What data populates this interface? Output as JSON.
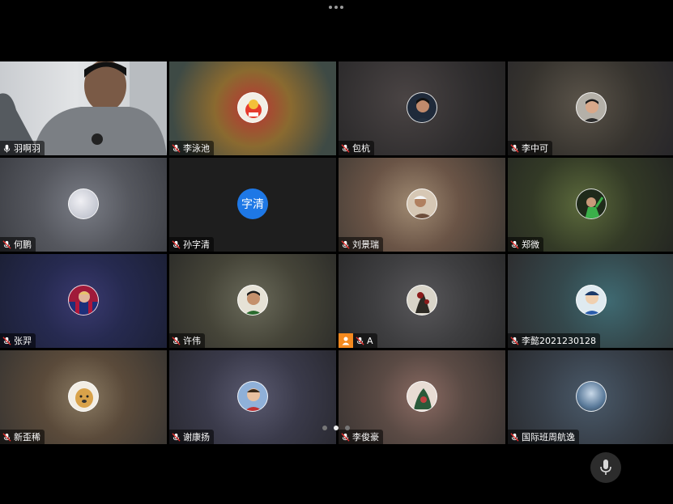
{
  "top_bar": {
    "more_icon": "more-dots-icon"
  },
  "participants": [
    {
      "name": "羽啊羽",
      "status_icon": "microphone-on-icon",
      "avatar": "camera-video",
      "accent": "#cfd3d6"
    },
    {
      "name": "李泳池",
      "status_icon": "microphone-muted-icon",
      "avatar": "photo",
      "accent": "#7c5a4a"
    },
    {
      "name": "包杭",
      "status_icon": "microphone-muted-icon",
      "avatar": "photo",
      "accent": "#3a3838"
    },
    {
      "name": "李中可",
      "status_icon": "microphone-muted-icon",
      "avatar": "photo",
      "accent": "#3c3a36"
    },
    {
      "name": "何鹏",
      "status_icon": "microphone-muted-icon",
      "avatar": "photo",
      "accent": "#55575e"
    },
    {
      "name": "孙字清",
      "status_icon": "microphone-muted-icon",
      "avatar": "text",
      "avatar_text": "字清",
      "accent": "#1e78e6"
    },
    {
      "name": "刘景瑞",
      "status_icon": "microphone-muted-icon",
      "avatar": "photo",
      "accent": "#5e4c40"
    },
    {
      "name": "郑微",
      "status_icon": "microphone-muted-icon",
      "avatar": "photo",
      "accent": "#2f3a26"
    },
    {
      "name": "张羿",
      "status_icon": "microphone-muted-icon",
      "avatar": "photo",
      "accent": "#2b3550"
    },
    {
      "name": "许伟",
      "status_icon": "microphone-muted-icon",
      "avatar": "photo",
      "accent": "#4a4a40"
    },
    {
      "name": "A",
      "status_icon": "microphone-muted-icon",
      "avatar": "photo",
      "badge": "person-icon",
      "accent": "#3e3e3e"
    },
    {
      "name": "李懿2021230128",
      "status_icon": "microphone-muted-icon",
      "avatar": "photo",
      "accent": "#3a5058"
    },
    {
      "name": "新歪稀",
      "status_icon": "microphone-muted-icon",
      "avatar": "photo",
      "accent": "#5a4a3a"
    },
    {
      "name": "谢康扬",
      "status_icon": "microphone-muted-icon",
      "avatar": "photo",
      "accent": "#3a3a48"
    },
    {
      "name": "李俊豪",
      "status_icon": "microphone-muted-icon",
      "avatar": "photo",
      "accent": "#5a4a44"
    },
    {
      "name": "国际班周航逸",
      "status_icon": "microphone-muted-icon",
      "avatar": "photo",
      "accent": "#38404a"
    }
  ],
  "pagination": {
    "pages": 3,
    "current": 2
  },
  "controls": {
    "mic_icon": "microphone-icon"
  }
}
